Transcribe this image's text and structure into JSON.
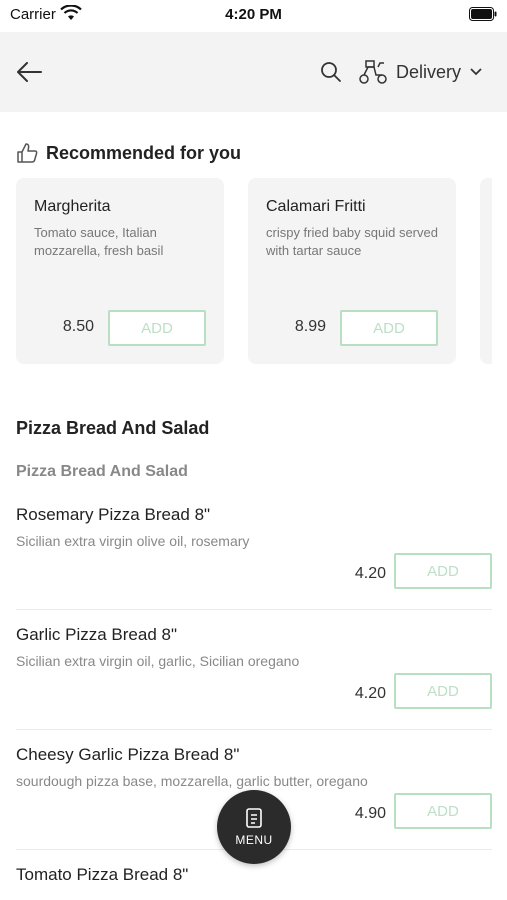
{
  "status_bar": {
    "carrier": "Carrier",
    "time": "4:20 PM"
  },
  "header": {
    "delivery_label": "Delivery"
  },
  "recommended": {
    "title": "Recommended for you",
    "cards": [
      {
        "name": "Margherita",
        "description": "Tomato sauce, Italian mozzarella, fresh basil",
        "price": "8.50",
        "add_label": "ADD"
      },
      {
        "name": "Calamari Fritti",
        "description": "crispy fried baby squid served with tartar sauce",
        "price": "8.99",
        "add_label": "ADD"
      }
    ]
  },
  "section": {
    "title": "Pizza Bread And Salad",
    "subtitle": "Pizza Bread And Salad",
    "items": [
      {
        "name": "Rosemary Pizza Bread 8\"",
        "description": "Sicilian extra virgin olive oil, rosemary",
        "price": "4.20",
        "add_label": "ADD"
      },
      {
        "name": "Garlic Pizza Bread 8\"",
        "description": "Sicilian extra virgin oil, garlic, Sicilian oregano",
        "price": "4.20",
        "add_label": "ADD"
      },
      {
        "name": "Cheesy Garlic Pizza Bread 8\"",
        "description": "sourdough pizza base, mozzarella, garlic butter, oregano",
        "price": "4.90",
        "add_label": "ADD"
      },
      {
        "name": "Tomato Pizza Bread 8\"",
        "description": "",
        "price": "",
        "add_label": ""
      }
    ]
  },
  "menu_button": {
    "label": "MENU"
  },
  "colors": {
    "accent_green": "#b7e0c2",
    "header_bg": "#f3f3f3",
    "fab_bg": "#2b2b2b"
  }
}
